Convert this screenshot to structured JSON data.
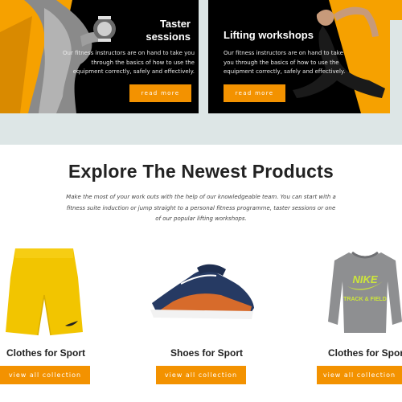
{
  "promos": [
    {
      "title": "Taster sessions",
      "title_line1": "Taster",
      "title_line2": "sessions",
      "text": "Our fitness instructors are on hand to take you through the basics of how to use the equipment correctly, safely and effectively.",
      "button": "read more"
    },
    {
      "title": "Lifting workshops",
      "text": "Our fitness instructors are on hand to take you through the basics of how to use the equipment correctly, safely and effectively.",
      "button": "read more"
    }
  ],
  "products_section": {
    "title": "Explore The Newest Products",
    "description": "Make the most of your work outs with the help of our knowledgeable team. You can start with a fitness suite induction or jump straight to a personal fitness programme, taster sessions or one of our popular lifting workshops.",
    "items": [
      {
        "name": "Clothes for Sport",
        "button": "view all collection",
        "image_icon": "yellow-shorts"
      },
      {
        "name": "Shoes for Sport",
        "button": "view all collection",
        "image_icon": "sneaker"
      },
      {
        "name": "Clothes for Sport",
        "button": "view all collection",
        "image_icon": "nike-sweatshirt"
      }
    ]
  },
  "sweatshirt_print": {
    "brand": "NIKE",
    "line2": "TRACK & FIELD"
  },
  "colors": {
    "accent": "#f39200",
    "card_bg": "#000000",
    "band_bg": "#dde6e6"
  }
}
